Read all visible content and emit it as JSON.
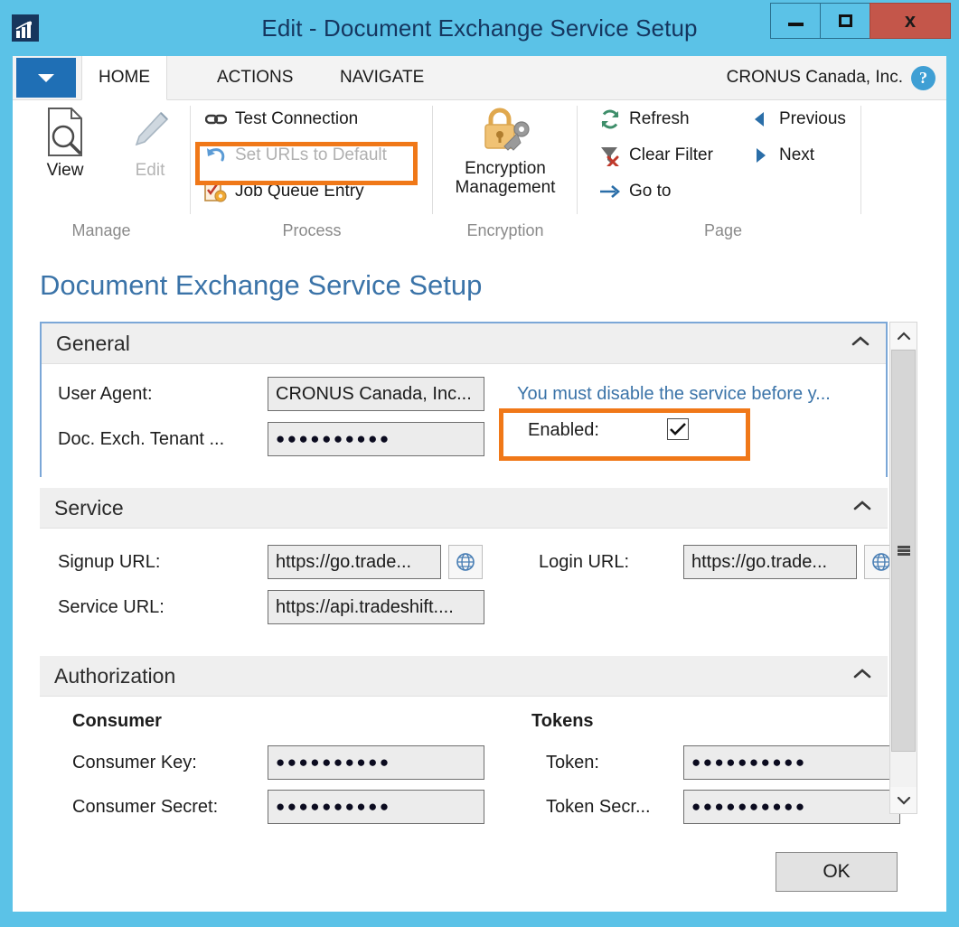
{
  "window": {
    "title": "Edit - Document Exchange Service Setup",
    "app_icon": "chart-app-icon",
    "minimize_label": "minimize",
    "maximize_label": "maximize",
    "close_label": "x"
  },
  "ribbon": {
    "dropdown_label": "chevron-down",
    "tabs": [
      {
        "label": "HOME",
        "active": true
      },
      {
        "label": "ACTIONS",
        "active": false
      },
      {
        "label": "NAVIGATE",
        "active": false
      }
    ],
    "company": "CRONUS Canada, Inc.",
    "help_label": "?",
    "groups": [
      {
        "name": "Manage",
        "label": "Manage",
        "buttons": [
          {
            "label": "View",
            "icon": "page-search-icon",
            "disabled": false
          },
          {
            "label": "Edit",
            "icon": "pencil-icon",
            "disabled": true
          }
        ]
      },
      {
        "name": "Process",
        "label": "Process",
        "buttons": [
          {
            "label": "Test Connection",
            "icon": "link-icon",
            "disabled": false
          },
          {
            "label": "Set URLs to Default",
            "icon": "undo-arrow-icon",
            "disabled": true,
            "highlighted": true
          },
          {
            "label": "Job Queue Entry",
            "icon": "checklist-gear-icon",
            "disabled": false
          }
        ]
      },
      {
        "name": "Encryption",
        "label": "Encryption",
        "buttons": [
          {
            "label": "Encryption Management",
            "icon": "lock-key-icon",
            "disabled": false
          }
        ]
      },
      {
        "name": "Page",
        "label": "Page",
        "buttons": [
          {
            "label": "Refresh",
            "icon": "refresh-icon",
            "disabled": false
          },
          {
            "label": "Clear Filter",
            "icon": "clear-filter-icon",
            "disabled": false
          },
          {
            "label": "Go to",
            "icon": "arrow-right-icon",
            "disabled": false
          },
          {
            "label": "Previous",
            "icon": "triangle-left-icon",
            "disabled": false
          },
          {
            "label": "Next",
            "icon": "triangle-right-icon",
            "disabled": false
          }
        ]
      }
    ]
  },
  "page": {
    "title": "Document Exchange Service Setup",
    "sections": [
      {
        "id": "general",
        "title": "General",
        "chevron": "chevron-up-icon",
        "fields": {
          "user_agent_label": "User Agent:",
          "user_agent_value": "CRONUS Canada, Inc...",
          "tenant_label": "Doc. Exch. Tenant ...",
          "tenant_value": "●●●●●●●●●●",
          "warning": "You must disable the service before y...",
          "enabled_label": "Enabled:",
          "enabled_checked": true,
          "enabled_check_glyph": "✔"
        }
      },
      {
        "id": "service",
        "title": "Service",
        "chevron": "chevron-up-icon",
        "fields": {
          "signup_url_label": "Signup URL:",
          "signup_url_value": "https://go.trade...",
          "service_url_label": "Service URL:",
          "service_url_value": "https://api.tradeshift....",
          "login_url_label": "Login URL:",
          "login_url_value": "https://go.trade...",
          "globe_icon": "globe-icon"
        }
      },
      {
        "id": "authorization",
        "title": "Authorization",
        "chevron": "chevron-up-icon",
        "fields": {
          "consumer_group_label": "Consumer",
          "consumer_key_label": "Consumer Key:",
          "consumer_key_value": "●●●●●●●●●●",
          "consumer_secret_label": "Consumer Secret:",
          "consumer_secret_value": "●●●●●●●●●●",
          "tokens_group_label": "Tokens",
          "token_label": "Token:",
          "token_value": "●●●●●●●●●●",
          "token_secret_label": "Token Secr...",
          "token_secret_value": "●●●●●●●●●●"
        }
      }
    ]
  },
  "scrollbar": {
    "up_label": "scroll-up",
    "down_label": "scroll-down"
  },
  "footer": {
    "ok_label": "OK"
  },
  "colors": {
    "window_chrome": "#5bc2e7",
    "title_text": "#15365f",
    "accent_blue": "#3a73a8",
    "highlight_orange": "#f07818",
    "close_red": "#c4564a",
    "dropdown_blue": "#1f6fb5"
  }
}
